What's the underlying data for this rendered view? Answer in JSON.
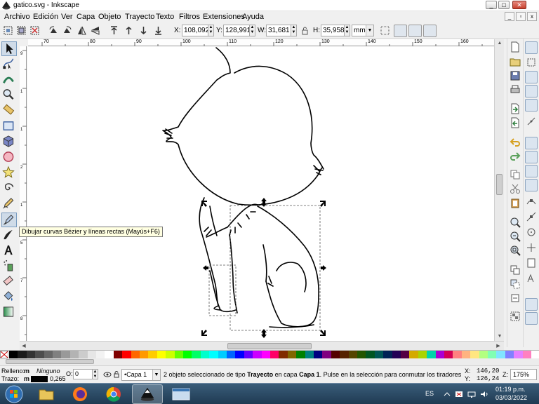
{
  "window": {
    "title": "gatico.svg - Inkscape",
    "min_label": "_",
    "max_label": "□",
    "close_label": "✕"
  },
  "menu": {
    "items": [
      "Archivo",
      "Edición",
      "Ver",
      "Capa",
      "Objeto",
      "Trayecto",
      "Texto",
      "Filtros",
      "Extensiones",
      "Ayuda"
    ]
  },
  "controls": {
    "x_label": "X:",
    "x_value": "108,092",
    "y_label": "Y:",
    "y_value": "128,991",
    "w_label": "W:",
    "w_value": "31,681",
    "h_label": "H:",
    "h_value": "35,958",
    "unit": "mm"
  },
  "rulers": {
    "h_ticks": [
      "70",
      "80",
      "90",
      "100",
      "110",
      "120",
      "130",
      "140",
      "150",
      "160"
    ],
    "v_ticks": [
      "9",
      "1",
      "1",
      "2",
      "1",
      "5",
      "7",
      "8"
    ]
  },
  "tooltip": {
    "text": "Dibujar curvas Bézier y líneas rectas (Mayús+F6)"
  },
  "status": {
    "fill_label": "Relleno:",
    "fill_mode": "m",
    "fill_value": "Ninguno",
    "stroke_label": "Trazo:",
    "stroke_mode": "m",
    "stroke_width": "0,265",
    "opacity_label": "O:",
    "opacity_value": "0",
    "layer": "•Capa 1",
    "message_part1": "2 objeto seleccionado de tipo ",
    "message_bold1": "Trayecto",
    "message_part2": " en capa ",
    "message_bold2": "Capa 1",
    "message_part3": ". Pulse en la selección para conmutar los tiradores d...",
    "x_label": "X:",
    "x_coord": "146,20",
    "y_label": "Y:",
    "y_coord": "126,24",
    "zoom_label": "Z:",
    "zoom_value": "175%"
  },
  "taskbar": {
    "lang": "ES",
    "time": "01:19 p.m.",
    "date": "03/03/2022"
  },
  "palette": {
    "colors": [
      "#000000",
      "#1a1a1a",
      "#333333",
      "#4d4d4d",
      "#666666",
      "#808080",
      "#999999",
      "#b3b3b3",
      "#cccccc",
      "#e6e6e6",
      "#f2f2f2",
      "#ffffff",
      "#800000",
      "#ff0000",
      "#ff6600",
      "#ff9900",
      "#ffcc00",
      "#ffff00",
      "#ccff00",
      "#66ff00",
      "#00ff00",
      "#00ff66",
      "#00ffcc",
      "#00ffff",
      "#00ccff",
      "#0066ff",
      "#0000ff",
      "#6600ff",
      "#cc00ff",
      "#ff00ff",
      "#ff0066",
      "#802b00",
      "#806600",
      "#008000",
      "#008080",
      "#000080",
      "#800080",
      "#550000",
      "#552200",
      "#554400",
      "#225500",
      "#005522",
      "#005555",
      "#002255",
      "#220055",
      "#550044",
      "#d4aa00",
      "#aad400",
      "#00d4aa",
      "#aa00d4",
      "#d40055",
      "#ff8080",
      "#ffb380",
      "#ffe680",
      "#b3ff80",
      "#80ffb3",
      "#80e5ff",
      "#8080ff",
      "#e580ff",
      "#ff80c0"
    ]
  }
}
